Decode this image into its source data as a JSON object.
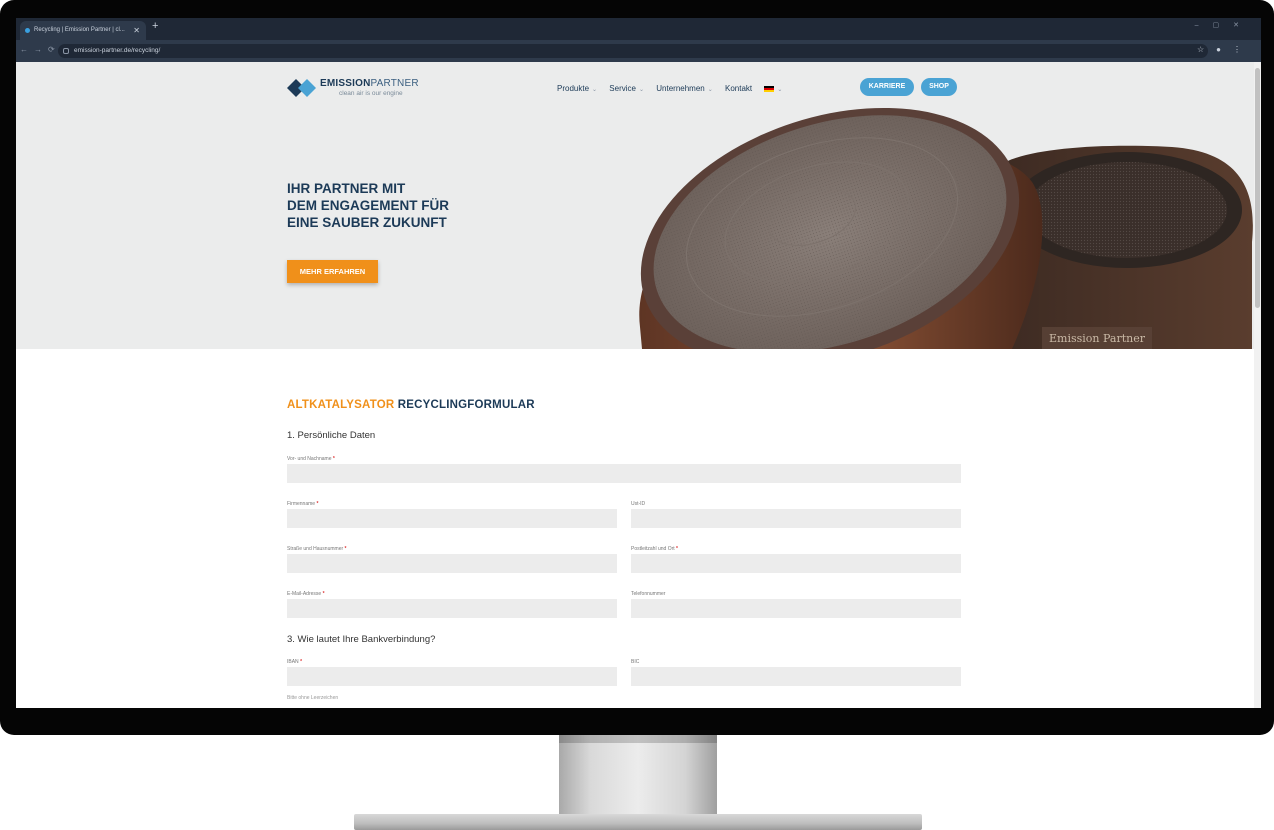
{
  "browser": {
    "tab_title": "Recycling | Emission Partner | cl...",
    "url": "emission-partner.de/recycling/"
  },
  "header": {
    "logo_name_bold": "EMISSION",
    "logo_name_light": "PARTNER",
    "logo_tagline": "clean air is our engine",
    "nav": [
      {
        "label": "Produkte"
      },
      {
        "label": "Service"
      },
      {
        "label": "Unternehmen"
      },
      {
        "label": "Kontakt"
      }
    ],
    "karriere_label": "KARRIERE",
    "shop_label": "SHOP"
  },
  "hero": {
    "title_lines": [
      "IHR PARTNER MIT",
      "DEM ENGAGEMENT FÜR",
      "EINE SAUBER ZUKUNFT"
    ],
    "cta_label": "MEHR ERFAHREN",
    "product_marking": "Emission Partner"
  },
  "form": {
    "title_part1": "ALTKATALYSATOR",
    "title_part2": "RECYCLINGFORMULAR",
    "section1": "1. Persönliche Daten",
    "section3": "3. Wie lautet Ihre Bankverbindung?",
    "fields": {
      "name": "Vor- und Nachname",
      "company": "Firmenname",
      "ust": "Ust-ID",
      "street": "Straße und Hausnummer",
      "zip": "Postleitzahl und Ort",
      "email": "E-Mail-Adresse",
      "phone": "Telefonnummer",
      "iban": "IBAN",
      "bic": "BIC"
    },
    "required_mark": "*",
    "hint": "Bitte ohne Leerzeichen"
  },
  "colors": {
    "brand_navy": "#1c3a57",
    "accent_orange": "#f0901a",
    "pill_blue": "#4aa3d4"
  }
}
